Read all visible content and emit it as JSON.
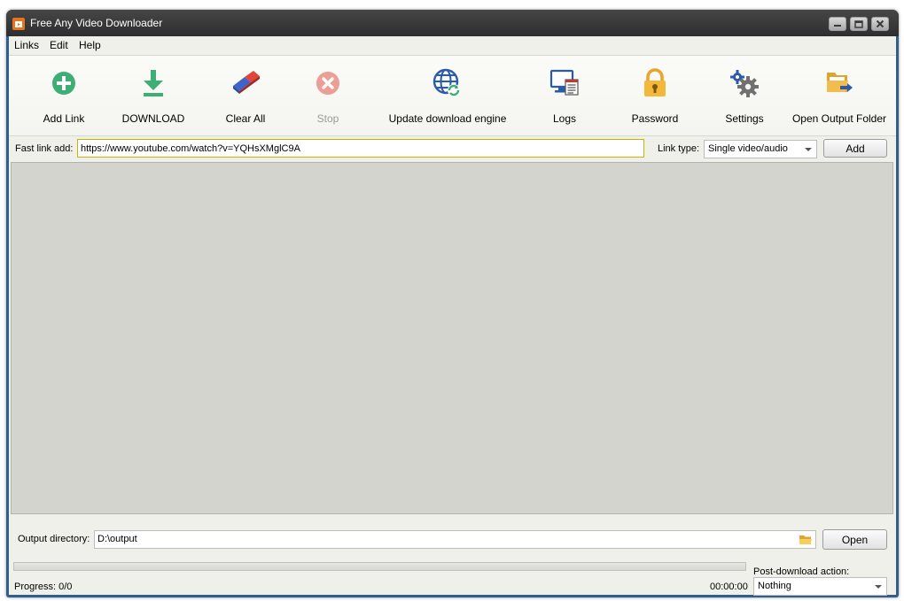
{
  "window": {
    "title": "Free Any Video Downloader",
    "controls": [
      "minimize-icon",
      "maximize-icon",
      "close-icon"
    ]
  },
  "menu": [
    "Links",
    "Edit",
    "Help"
  ],
  "toolbar": {
    "items": [
      {
        "label": "Add Link",
        "icon": "add-circle-icon",
        "enabled": true
      },
      {
        "label": "DOWNLOAD",
        "icon": "download-arrow-icon",
        "enabled": true
      },
      {
        "label": "Clear All",
        "icon": "eraser-icon",
        "enabled": true
      },
      {
        "label": "Stop",
        "icon": "stop-x-icon",
        "enabled": false
      },
      {
        "label": "Update download engine",
        "icon": "globe-refresh-icon",
        "enabled": true
      },
      {
        "label": "Logs",
        "icon": "logs-monitor-icon",
        "enabled": true
      },
      {
        "label": "Password",
        "icon": "padlock-icon",
        "enabled": true
      },
      {
        "label": "Settings",
        "icon": "gears-icon",
        "enabled": true
      },
      {
        "label": "Open Output Folder",
        "icon": "folder-arrow-icon",
        "enabled": true
      }
    ]
  },
  "fast_link": {
    "label": "Fast link add:",
    "value": "https://www.youtube.com/watch?v=YQHsXMglC9A",
    "link_type_label": "Link type:",
    "link_type_value": "Single video/audio",
    "add_label": "Add"
  },
  "output": {
    "label": "Output directory:",
    "value": "D:\\output",
    "open_label": "Open"
  },
  "status": {
    "progress_text": "Progress: 0/0",
    "progress_fraction": 0,
    "elapsed": "00:00:00",
    "post_action_label": "Post-download action:",
    "post_action_value": "Nothing"
  },
  "colors": {
    "title_bar": "#3a3a3a",
    "frame": "#2f5f8c",
    "accent_green": "#3fae74",
    "input_highlight": "#c8b400"
  }
}
